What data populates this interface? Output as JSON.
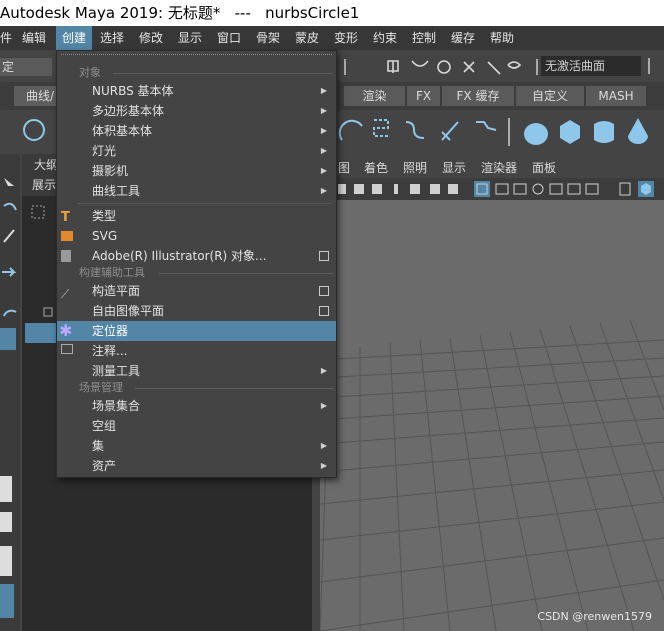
{
  "window": {
    "title": "Autodesk Maya 2019: 无标题*   ---   nurbsCircle1"
  },
  "menubar": {
    "items": [
      {
        "id": "file",
        "label": "件"
      },
      {
        "id": "edit",
        "label": "编辑"
      },
      {
        "id": "create",
        "label": "创建"
      },
      {
        "id": "select",
        "label": "选择"
      },
      {
        "id": "modify",
        "label": "修改"
      },
      {
        "id": "display",
        "label": "显示"
      },
      {
        "id": "window",
        "label": "窗口"
      },
      {
        "id": "skeleton",
        "label": "骨架"
      },
      {
        "id": "skin",
        "label": "蒙皮"
      },
      {
        "id": "deform",
        "label": "变形"
      },
      {
        "id": "constrain",
        "label": "约束"
      },
      {
        "id": "control",
        "label": "控制"
      },
      {
        "id": "cache",
        "label": "缓存"
      },
      {
        "id": "help",
        "label": "帮助"
      }
    ]
  },
  "statusline": {
    "left_label": "定",
    "no_live_surface": "无激活曲面"
  },
  "shelf_tabs": {
    "left_tab": "曲线/",
    "tabs": [
      "渲染",
      "FX",
      "FX 缓存",
      "自定义",
      "MASH"
    ]
  },
  "outliner": {
    "tab": "大纲",
    "show": "展示"
  },
  "viewport_menu": {
    "items": [
      "图",
      "着色",
      "照明",
      "显示",
      "渲染器",
      "面板"
    ]
  },
  "create_menu": {
    "sections": [
      {
        "id": "objects",
        "label": "对象"
      },
      {
        "id": "construction",
        "label": "构建辅助工具"
      },
      {
        "id": "scene",
        "label": "场景管理"
      }
    ],
    "items": {
      "nurbs": "NURBS 基本体",
      "poly": "多边形基本体",
      "volume": "体积基本体",
      "lights": "灯光",
      "cameras": "摄影机",
      "curve_tools": "曲线工具",
      "type": "类型",
      "svg": "SVG",
      "illustrator": "Adobe(R) Illustrator(R) 对象...",
      "construction_plane": "构造平面",
      "free_image_plane": "自由图像平面",
      "locator": "定位器",
      "annotation": "注释...",
      "measure_tools": "测量工具",
      "scene_assembly": "场景集合",
      "empty_group": "空组",
      "sets": "集",
      "assets": "资产"
    }
  },
  "watermark": "CSDN @renwen1579",
  "colors": {
    "highlight": "#5285a6",
    "menu_bg": "#444444",
    "viewport_bg": "#6b6b6b"
  }
}
